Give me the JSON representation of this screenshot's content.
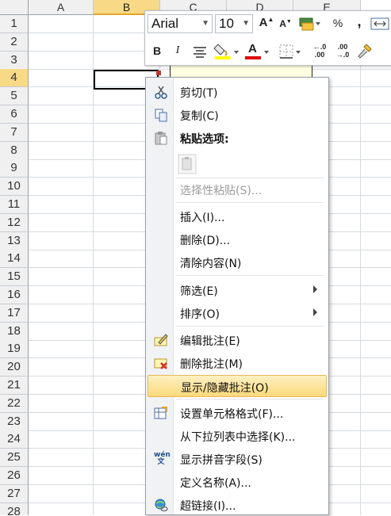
{
  "sheet": {
    "columns": [
      {
        "label": "A",
        "selected": false
      },
      {
        "label": "B",
        "selected": true
      },
      {
        "label": "C",
        "selected": false
      },
      {
        "label": "D",
        "selected": false
      },
      {
        "label": "E",
        "selected": false
      }
    ],
    "rows": [
      "1",
      "2",
      "3",
      "4",
      "5",
      "6",
      "7",
      "8",
      "9",
      "10",
      "11",
      "12",
      "13",
      "14",
      "15",
      "16",
      "17",
      "18",
      "19",
      "20",
      "21",
      "22",
      "23",
      "24",
      "25",
      "26",
      "27",
      "28"
    ],
    "selected_row": "4"
  },
  "mini_toolbar": {
    "font_name": "Arial",
    "font_size": "10",
    "grow_font": "A",
    "shrink_font": "A",
    "percent": "%",
    "comma": ",",
    "bold": "B",
    "italic": "I",
    "font_color": "A",
    "increase_decimal": "←.0\n.00",
    "decrease_decimal": ".00\n→.0",
    "colors": {
      "highlight": "#ffff00",
      "font_color": "#e00000"
    }
  },
  "context_menu": {
    "items": [
      {
        "label": "剪切(T)",
        "icon": "scissors-icon",
        "state": "normal"
      },
      {
        "label": "复制(C)",
        "icon": "copy-icon",
        "state": "normal"
      },
      {
        "label": "粘贴选项:",
        "icon": "paste-icon",
        "state": "bold"
      },
      {
        "label": "",
        "icon": "paste-option-icon",
        "state": "normal"
      },
      {
        "label": "选择性粘贴(S)...",
        "icon": "",
        "state": "disabled"
      },
      {
        "label": "插入(I)...",
        "icon": "",
        "state": "normal"
      },
      {
        "label": "删除(D)...",
        "icon": "",
        "state": "normal"
      },
      {
        "label": "清除内容(N)",
        "icon": "",
        "state": "normal"
      },
      {
        "label": "筛选(E)",
        "icon": "",
        "state": "submenu"
      },
      {
        "label": "排序(O)",
        "icon": "",
        "state": "submenu"
      },
      {
        "label": "编辑批注(E)",
        "icon": "edit-comment-icon",
        "state": "normal"
      },
      {
        "label": "删除批注(M)",
        "icon": "delete-comment-icon",
        "state": "normal"
      },
      {
        "label": "显示/隐藏批注(O)",
        "icon": "",
        "state": "highlighted"
      },
      {
        "label": "设置单元格格式(F)...",
        "icon": "format-cells-icon",
        "state": "normal"
      },
      {
        "label": "从下拉列表中选择(K)...",
        "icon": "",
        "state": "normal"
      },
      {
        "label": "显示拼音字段(S)",
        "icon": "phonetic-icon",
        "state": "normal"
      },
      {
        "label": "定义名称(A)...",
        "icon": "",
        "state": "normal"
      },
      {
        "label": "超链接(I)...",
        "icon": "hyperlink-icon",
        "state": "normal"
      }
    ],
    "phonetic_glyph": "wén\n文",
    "highlight_color": "#fbd97b"
  }
}
